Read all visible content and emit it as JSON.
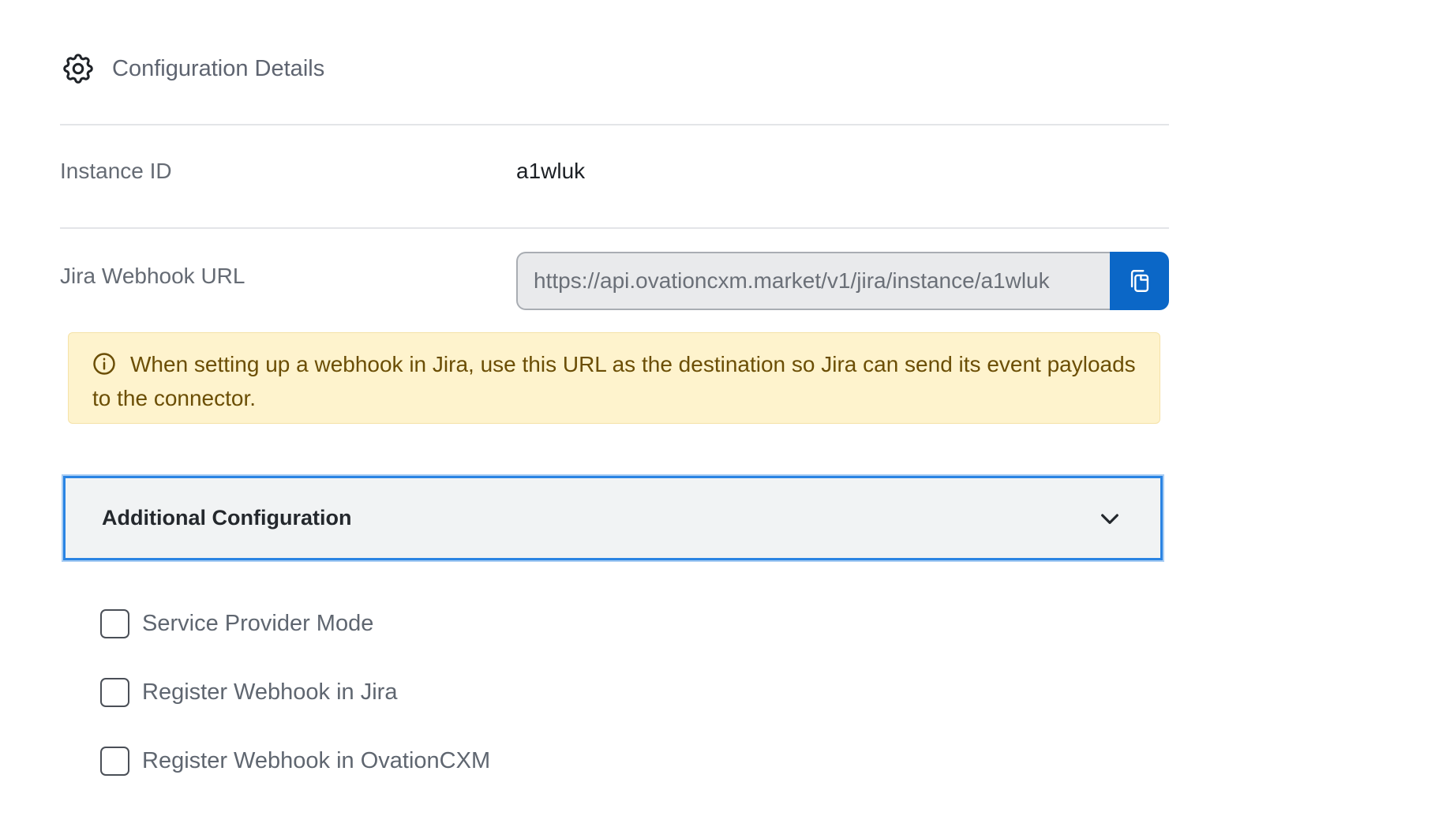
{
  "header": {
    "title": "Configuration Details",
    "icon": "gear-icon"
  },
  "instance": {
    "label": "Instance ID",
    "value": "a1wluk"
  },
  "webhook": {
    "label": "Jira Webhook URL",
    "url": "https://api.ovationcxm.market/v1/jira/instance/a1wluk",
    "copy_icon": "copy-icon"
  },
  "alert": {
    "icon": "info-icon",
    "text": "When setting up a webhook in Jira, use this URL as the destination so Jira can send its event payloads to the connector."
  },
  "accordion": {
    "title": "Additional Configuration",
    "icon": "chevron-down-icon"
  },
  "options": [
    {
      "label": "Service Provider Mode",
      "checked": false
    },
    {
      "label": "Register Webhook in Jira",
      "checked": false
    },
    {
      "label": "Register Webhook in OvationCXM",
      "checked": false
    }
  ],
  "colors": {
    "accent": "#0b67c7",
    "focus_border": "#2a84e3",
    "alert_bg": "#fef3cd",
    "alert_text": "#6b4e05"
  }
}
